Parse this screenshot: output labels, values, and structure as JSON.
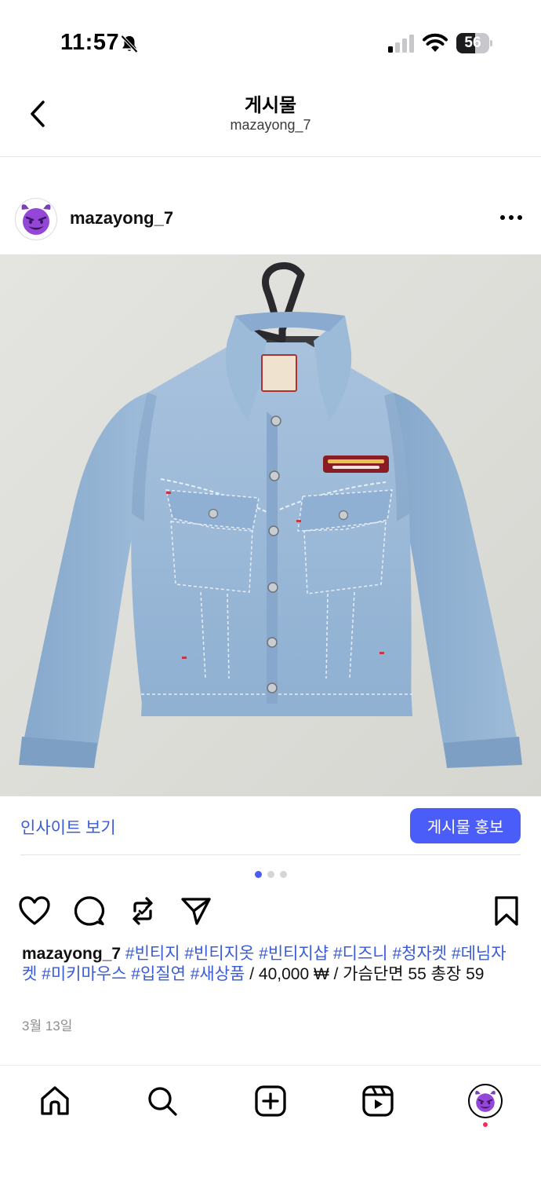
{
  "status_bar": {
    "time": "11:57",
    "battery_level": 56,
    "battery_label": "56",
    "icons": [
      "bell-slash-icon",
      "signal-icon",
      "wifi-icon",
      "battery-icon"
    ]
  },
  "header": {
    "title": "게시물",
    "subtitle": "mazayong_7",
    "back_icon": "chevron-left-icon"
  },
  "post": {
    "username": "mazayong_7",
    "avatar_icon": "smiling-devil-emoji",
    "more_icon": "ellipsis-icon",
    "image_subject": "light-wash denim jacket on hanger"
  },
  "insight": {
    "link_label": "인사이트 보기",
    "promote_label": "게시물 홍보",
    "accent_color": "#4a5df9"
  },
  "carousel": {
    "count": 3,
    "active_index": 0
  },
  "actions": {
    "icons": [
      "heart-icon",
      "comment-icon",
      "repost-icon",
      "send-icon",
      "bookmark-icon"
    ]
  },
  "caption": {
    "username": "mazayong_7",
    "hashtags": "#빈티지 #빈티지옷 #빈티지샵 #디즈니 #청자켓 #데님자켓 #미키마우스 #입질연 #새상품",
    "text": " / 40,000 ₩ / 가슴단면 55 총장 59"
  },
  "date": "3월 13일",
  "tab_bar": {
    "icons": [
      "home-icon",
      "search-icon",
      "create-icon",
      "reels-icon",
      "profile-avatar"
    ],
    "notification_color": "#ff2d55"
  }
}
